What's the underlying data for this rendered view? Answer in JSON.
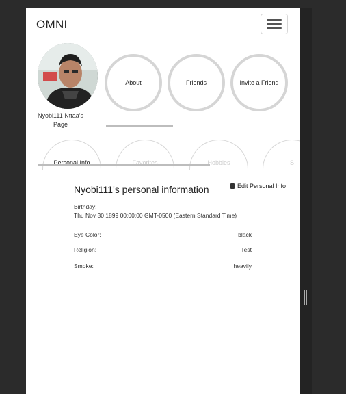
{
  "header": {
    "brand": "OMNI"
  },
  "profile": {
    "owner_name": "Nyobi111 Nttaa's Page"
  },
  "nav_circles": [
    {
      "label": "About"
    },
    {
      "label": "Friends"
    },
    {
      "label": "Invite a Friend"
    }
  ],
  "tabs": [
    {
      "label": "Personal Info"
    },
    {
      "label": "Favorites"
    },
    {
      "label": "Hobbies"
    },
    {
      "label": "S"
    }
  ],
  "personal_info": {
    "title": "Nyobi111's personal information",
    "edit_label": "Edit Personal Info",
    "birthday_label": "Birthday:",
    "birthday_value": "Thu Nov 30 1899 00:00:00 GMT-0500 (Eastern Standard Time)",
    "eye_color_label": "Eye Color:",
    "eye_color_value": "black",
    "religion_label": "Religion:",
    "religion_value": "Test",
    "smoke_label": "Smoke:",
    "smoke_value": "heavily"
  }
}
